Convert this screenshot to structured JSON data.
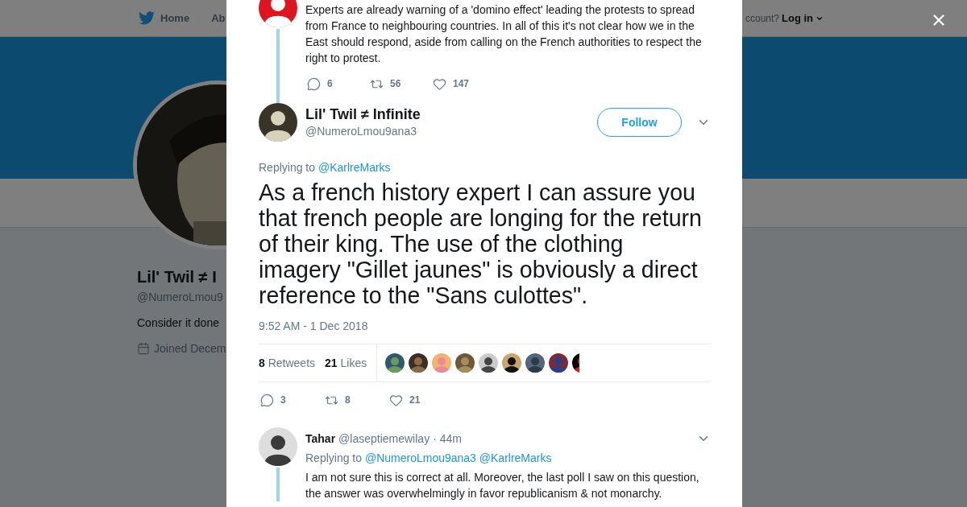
{
  "background_page": {
    "nav": {
      "home": "Home",
      "about": "Ab",
      "account_prompt": "ccount?",
      "login": "Log in"
    },
    "profile": {
      "name": "Lil' Twil ≠ I",
      "handle": "@NumeroLmou9",
      "bio": "Consider it done",
      "joined": "Joined Decem"
    }
  },
  "modal": {
    "previous_tweet": {
      "text": "Experts are already warning of a 'domino effect' leading the protests to spread from France to neighbouring countries. In all of this it's not clear how we in the East should respond, aside from calling on the French authorities to respect the right to protest.",
      "actions": [
        {
          "kind": "reply",
          "count": "6"
        },
        {
          "kind": "retweet",
          "count": "56"
        },
        {
          "kind": "like",
          "count": "147"
        }
      ]
    },
    "tweet": {
      "name": "Lil' Twil ≠ Infinite",
      "handle": "@NumeroLmou9ana3",
      "follow_button": "Follow",
      "replying_label": "Replying to",
      "replying_to": [
        "@KarlreMarks"
      ],
      "text": "As a french history expert I can assure you that french people are longing for the return of their king. The use of the clothing imagery \"Gillet jaunes\" is obviously a direct reference to the \"Sans culottes\".",
      "timestamp": "9:52 AM - 1 Dec 2018",
      "stats": [
        {
          "count": "8",
          "label": "Retweets"
        },
        {
          "count": "21",
          "label": "Likes"
        }
      ],
      "liker_avatars": [
        {
          "kind": "picture"
        },
        {
          "kind": "picture"
        },
        {
          "kind": "picture"
        },
        {
          "kind": "picture"
        },
        {
          "kind": "picture"
        },
        {
          "kind": "picture"
        },
        {
          "kind": "picture"
        },
        {
          "kind": "picture"
        },
        {
          "kind": "picture"
        }
      ],
      "actions": [
        {
          "kind": "reply",
          "count": "3"
        },
        {
          "kind": "retweet",
          "count": "8"
        },
        {
          "kind": "like",
          "count": "21"
        }
      ]
    },
    "replies": [
      {
        "name": "Tahar",
        "handle": "@laseptiemewilay",
        "time": "· 44m",
        "replying_label": "Replying to",
        "replying_to": [
          "@NumeroLmou9ana3",
          "@KarlreMarks"
        ],
        "text": "I am not sure this is correct at all. Moreover, the last poll I saw on this question, the answer was overwhelmingly in favor republicanism & not monarchy."
      }
    ]
  }
}
